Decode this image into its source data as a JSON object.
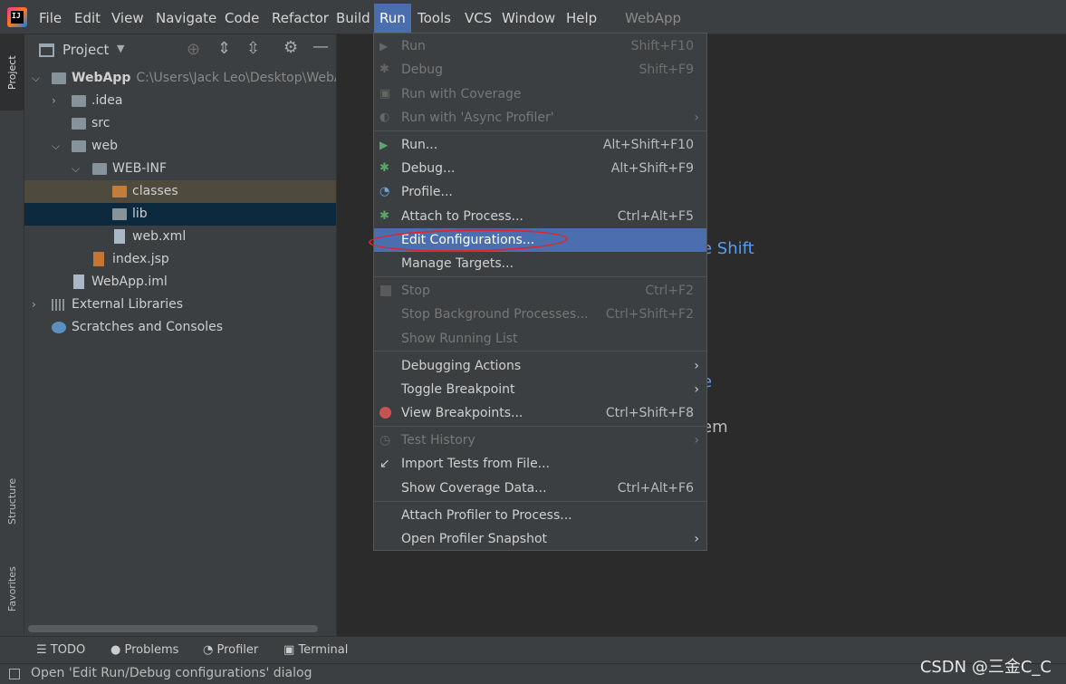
{
  "menubar": {
    "items": [
      "File",
      "Edit",
      "View",
      "Navigate",
      "Code",
      "Refactor",
      "Build",
      "Run",
      "Tools",
      "VCS",
      "Window",
      "Help"
    ],
    "project_title": "WebApp"
  },
  "left_strip": {
    "project": "Project",
    "structure": "Structure",
    "favorites": "Favorites"
  },
  "project_panel": {
    "title": "Project",
    "tree": [
      {
        "label": "WebApp",
        "path": "C:\\Users\\Jack Leo\\Desktop\\WebAp"
      },
      {
        "label": ".idea"
      },
      {
        "label": "src"
      },
      {
        "label": "web"
      },
      {
        "label": "WEB-INF"
      },
      {
        "label": "classes"
      },
      {
        "label": "lib"
      },
      {
        "label": "web.xml"
      },
      {
        "label": "index.jsp"
      },
      {
        "label": "WebApp.iml"
      },
      {
        "label": "External Libraries"
      },
      {
        "label": "Scratches and Consoles"
      }
    ]
  },
  "editor": {
    "hint1": "e Shift",
    "hint2": "e",
    "hint3": "em"
  },
  "run_menu": {
    "items": [
      {
        "label": "Run",
        "shortcut": "Shift+F10"
      },
      {
        "label": "Debug",
        "shortcut": "Shift+F9"
      },
      {
        "label": "Run with Coverage",
        "shortcut": ""
      },
      {
        "label": "Run with 'Async Profiler'",
        "shortcut": ""
      },
      {
        "label": "Run...",
        "shortcut": "Alt+Shift+F10"
      },
      {
        "label": "Debug...",
        "shortcut": "Alt+Shift+F9"
      },
      {
        "label": "Profile...",
        "shortcut": ""
      },
      {
        "label": "Attach to Process...",
        "shortcut": "Ctrl+Alt+F5"
      },
      {
        "label": "Edit Configurations...",
        "shortcut": ""
      },
      {
        "label": "Manage Targets...",
        "shortcut": ""
      },
      {
        "label": "Stop",
        "shortcut": "Ctrl+F2"
      },
      {
        "label": "Stop Background Processes...",
        "shortcut": "Ctrl+Shift+F2"
      },
      {
        "label": "Show Running List",
        "shortcut": ""
      },
      {
        "label": "Debugging Actions",
        "shortcut": ""
      },
      {
        "label": "Toggle Breakpoint",
        "shortcut": ""
      },
      {
        "label": "View Breakpoints...",
        "shortcut": "Ctrl+Shift+F8"
      },
      {
        "label": "Test History",
        "shortcut": ""
      },
      {
        "label": "Import Tests from File...",
        "shortcut": ""
      },
      {
        "label": "Show Coverage Data...",
        "shortcut": "Ctrl+Alt+F6"
      },
      {
        "label": "Attach Profiler to Process...",
        "shortcut": ""
      },
      {
        "label": "Open Profiler Snapshot",
        "shortcut": ""
      }
    ]
  },
  "bottombar": {
    "todo": "TODO",
    "problems": "Problems",
    "profiler": "Profiler",
    "terminal": "Terminal"
  },
  "status": {
    "text": "Open 'Edit Run/Debug configurations' dialog"
  },
  "watermark": "CSDN @三金C_C",
  "colors": {
    "accent": "#4b6eaf",
    "annotation": "#e0262c",
    "link": "#589df6"
  }
}
